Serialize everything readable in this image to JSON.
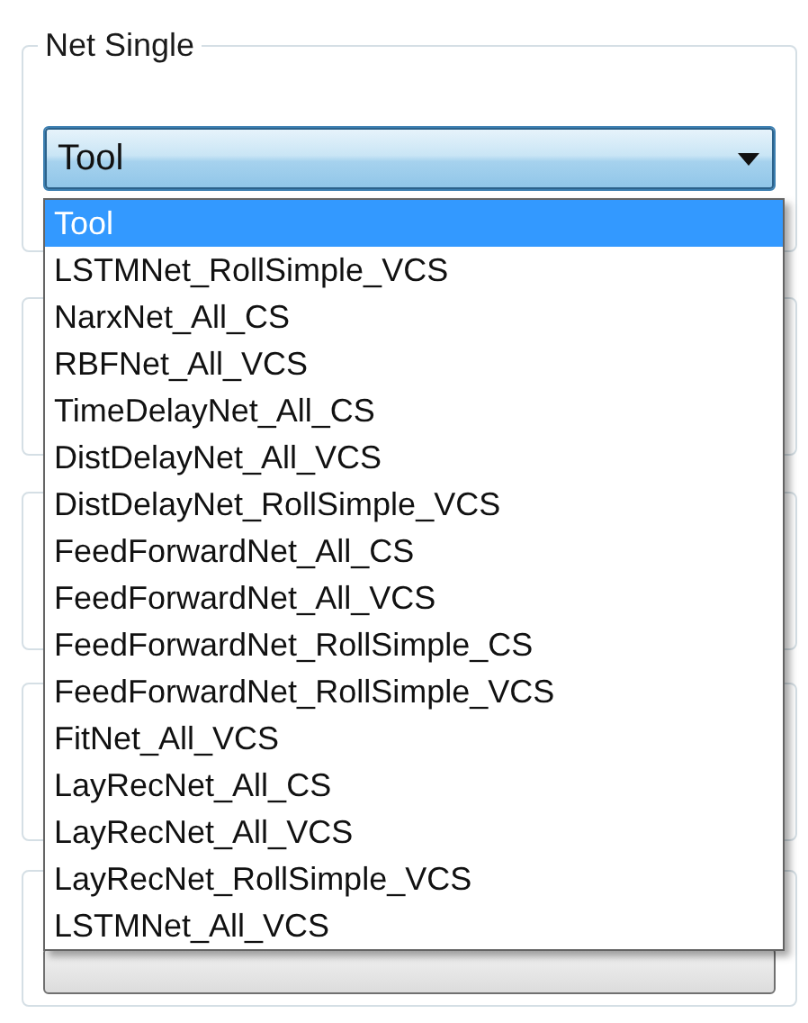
{
  "group": {
    "title": "Net Single"
  },
  "combo": {
    "value": "Tool",
    "expanded": true
  },
  "dropdown": {
    "items": [
      {
        "label": "Tool",
        "selected": true
      },
      {
        "label": "LSTMNet_RollSimple_VCS",
        "selected": false
      },
      {
        "label": "NarxNet_All_CS",
        "selected": false
      },
      {
        "label": "RBFNet_All_VCS",
        "selected": false
      },
      {
        "label": "TimeDelayNet_All_CS",
        "selected": false
      },
      {
        "label": "DistDelayNet_All_VCS",
        "selected": false
      },
      {
        "label": "DistDelayNet_RollSimple_VCS",
        "selected": false
      },
      {
        "label": "FeedForwardNet_All_CS",
        "selected": false
      },
      {
        "label": "FeedForwardNet_All_VCS",
        "selected": false
      },
      {
        "label": "FeedForwardNet_RollSimple_CS",
        "selected": false
      },
      {
        "label": "FeedForwardNet_RollSimple_VCS",
        "selected": false
      },
      {
        "label": "FitNet_All_VCS",
        "selected": false
      },
      {
        "label": "LayRecNet_All_CS",
        "selected": false
      },
      {
        "label": "LayRecNet_All_VCS",
        "selected": false
      },
      {
        "label": "LayRecNet_RollSimple_VCS",
        "selected": false
      },
      {
        "label": "LSTMNet_All_VCS",
        "selected": false
      }
    ]
  }
}
